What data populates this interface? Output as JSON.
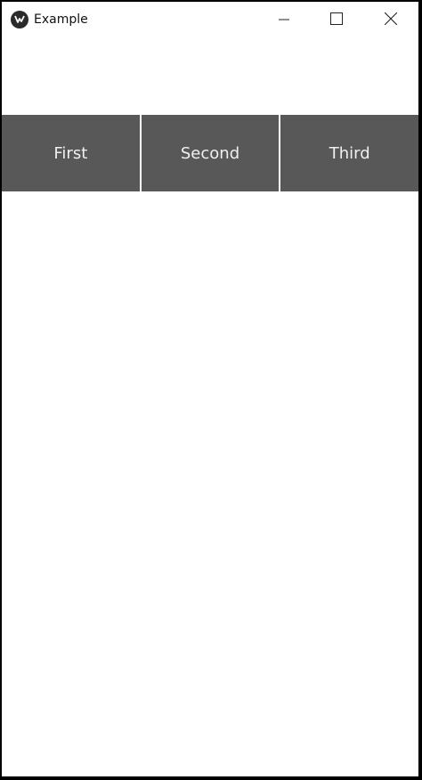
{
  "window": {
    "title": "Example",
    "icon": "kivy-logo-icon",
    "controls": {
      "minimize": "minimize-icon",
      "maximize": "maximize-icon",
      "close": "close-icon"
    }
  },
  "buttons": [
    {
      "label": "First"
    },
    {
      "label": "Second"
    },
    {
      "label": "Third"
    }
  ],
  "colors": {
    "button_bg": "#585858",
    "button_text": "#f0f0f0",
    "window_bg": "#ffffff",
    "frame": "#000000"
  }
}
